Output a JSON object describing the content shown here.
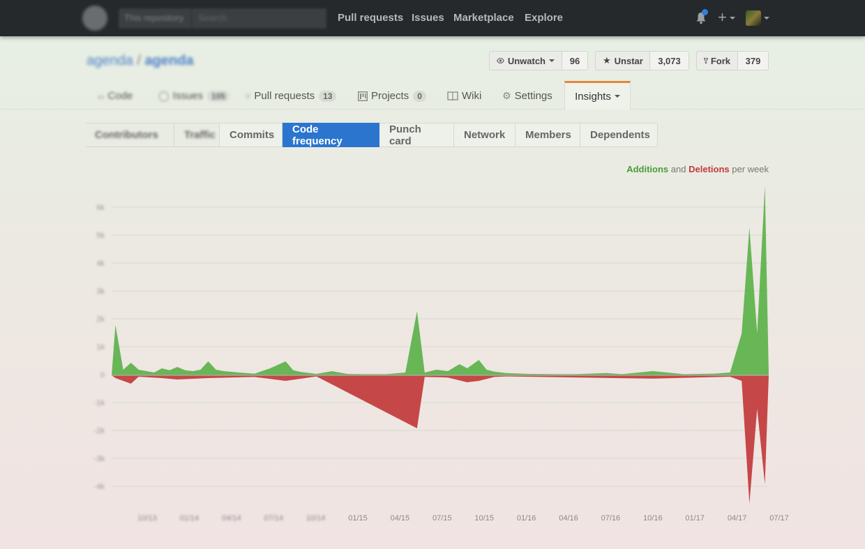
{
  "header": {
    "scope_label": "This repository",
    "search_placeholder": "Search",
    "nav": [
      "Pull requests",
      "Issues",
      "Marketplace",
      "Explore"
    ],
    "plus_symbol": "+"
  },
  "repo": {
    "owner": "agenda",
    "separator": "/",
    "name": "agenda",
    "watch": {
      "label": "Unwatch",
      "count": "96"
    },
    "star": {
      "label": "Unstar",
      "count": "3,073"
    },
    "fork": {
      "label": "Fork",
      "count": "379"
    }
  },
  "repo_tabs": {
    "code": "Code",
    "issues": {
      "label": "Issues",
      "count": "105"
    },
    "pulls": {
      "label": "Pull requests",
      "count": "13"
    },
    "projects": {
      "label": "Projects",
      "count": "0"
    },
    "wiki": "Wiki",
    "settings": "Settings",
    "insights": "Insights"
  },
  "insights_tabs": [
    "Contributors",
    "Traffic",
    "Commits",
    "Code frequency",
    "Punch card",
    "Network",
    "Members",
    "Dependents"
  ],
  "active_insights_tab": "Code frequency",
  "legend": {
    "additions": "Additions",
    "and": "and",
    "deletions": "Deletions",
    "suffix": "per week"
  },
  "colors": {
    "additions": "#5cb24a",
    "deletions": "#c23a3a",
    "accent": "#2b75cf",
    "tab_underline": "#e3873d"
  },
  "chart_data": {
    "type": "area",
    "title": "",
    "x_tick_labels": [
      "10/13",
      "01/14",
      "04/14",
      "07/14",
      "10/14",
      "01/15",
      "04/15",
      "07/15",
      "10/15",
      "01/16",
      "04/16",
      "07/16",
      "10/16",
      "01/17",
      "04/17",
      "07/17"
    ],
    "y_tick_labels": [
      "6k",
      "5k",
      "4k",
      "3k",
      "2k",
      "1k",
      "0",
      "-1k",
      "-2k",
      "-3k",
      "-4k"
    ],
    "ylim": [
      -4500,
      6800
    ],
    "grid": true,
    "series": [
      {
        "name": "Additions",
        "color": "#5cb24a",
        "points": [
          [
            0,
            0
          ],
          [
            0.5,
            1800
          ],
          [
            1.5,
            200
          ],
          [
            2.5,
            450
          ],
          [
            3.5,
            200
          ],
          [
            4.5,
            150
          ],
          [
            5.5,
            100
          ],
          [
            6.5,
            250
          ],
          [
            7.5,
            180
          ],
          [
            8.5,
            300
          ],
          [
            9.5,
            180
          ],
          [
            10.5,
            150
          ],
          [
            11.5,
            200
          ],
          [
            12.5,
            500
          ],
          [
            13.5,
            200
          ],
          [
            14.5,
            150
          ],
          [
            16.5,
            100
          ],
          [
            18.5,
            60
          ],
          [
            20.5,
            250
          ],
          [
            22.5,
            500
          ],
          [
            23.5,
            180
          ],
          [
            24.5,
            120
          ],
          [
            26.5,
            50
          ],
          [
            28.5,
            150
          ],
          [
            30.5,
            50
          ],
          [
            32.5,
            40
          ],
          [
            35.5,
            40
          ],
          [
            38,
            100
          ],
          [
            39.5,
            2300
          ],
          [
            40.5,
            100
          ],
          [
            42,
            200
          ],
          [
            43.5,
            150
          ],
          [
            45,
            400
          ],
          [
            46,
            250
          ],
          [
            47.5,
            550
          ],
          [
            48.5,
            200
          ],
          [
            49.5,
            130
          ],
          [
            51,
            80
          ],
          [
            54,
            50
          ],
          [
            58,
            40
          ],
          [
            60,
            40
          ],
          [
            64,
            80
          ],
          [
            66,
            40
          ],
          [
            70,
            150
          ],
          [
            74,
            40
          ],
          [
            78,
            60
          ],
          [
            80,
            100
          ],
          [
            81.5,
            1500
          ],
          [
            82.5,
            5300
          ],
          [
            83.5,
            1500
          ],
          [
            84.5,
            6800
          ],
          [
            85,
            0
          ]
        ]
      },
      {
        "name": "Deletions",
        "color": "#c23a3a",
        "points": [
          [
            0,
            0
          ],
          [
            0.5,
            -100
          ],
          [
            1.5,
            -200
          ],
          [
            2.5,
            -300
          ],
          [
            3.5,
            -50
          ],
          [
            6.5,
            -100
          ],
          [
            8.5,
            -150
          ],
          [
            12.5,
            -100
          ],
          [
            18.5,
            -60
          ],
          [
            22.5,
            -200
          ],
          [
            26.5,
            -40
          ],
          [
            39.5,
            -1900
          ],
          [
            40.5,
            -60
          ],
          [
            43.5,
            -80
          ],
          [
            46,
            -250
          ],
          [
            47.5,
            -200
          ],
          [
            49.5,
            -60
          ],
          [
            51,
            -40
          ],
          [
            70,
            -120
          ],
          [
            80,
            -50
          ],
          [
            81.5,
            -200
          ],
          [
            82.5,
            -4600
          ],
          [
            83.5,
            -1200
          ],
          [
            84.5,
            -3900
          ],
          [
            85,
            0
          ]
        ]
      }
    ]
  }
}
